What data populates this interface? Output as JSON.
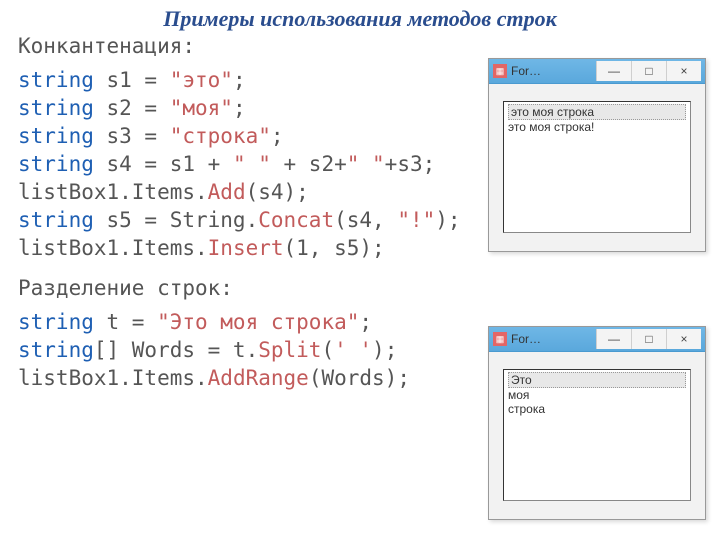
{
  "title": "Примеры использования методов строк",
  "sec1": "Конкантенация:",
  "sec2": "Разделение строк:",
  "c1": {
    "l1p1": "string",
    "l1p2": " s1 = ",
    "l1p3": "\"это\"",
    "l1p4": ";",
    "l2p1": "string",
    "l2p2": " s2 = ",
    "l2p3": "\"моя\"",
    "l2p4": ";",
    "l3p1": "string",
    "l3p2": " s3 = ",
    "l3p3": "\"строка\"",
    "l3p4": ";",
    "l4p1": "string",
    "l4p2": " s4 = s1 + ",
    "l4p3": "\" \"",
    "l4p4": " + s2+",
    "l4p5": "\" \"",
    "l4p6": "+s3;",
    "l5p1": "listBox1.Items.",
    "l5p2": "Add",
    "l5p3": "(s4);",
    "l6p1": "string",
    "l6p2": " s5 = String.",
    "l6p3": "Concat",
    "l6p4": "(s4, ",
    "l6p5": "\"!\"",
    "l6p6": ");",
    "l7p1": "listBox1.Items.",
    "l7p2": "Insert",
    "l7p3": "(1, s5);"
  },
  "c2": {
    "l1p1": "string",
    "l1p2": " t = ",
    "l1p3": "\"Это моя строка\"",
    "l1p4": ";",
    "l2p1": "string",
    "l2p2": "[] Words = t.",
    "l2p3": "Split",
    "l2p4": "(",
    "l2p5": "' '",
    "l2p6": ");",
    "l3p1": "listBox1.Items.",
    "l3p2": "AddRange",
    "l3p3": "(Words);"
  },
  "win": {
    "title": "For…",
    "min": "—",
    "max": "□",
    "close": "×"
  },
  "list1": {
    "a": "это моя строка",
    "b": "это моя строка!"
  },
  "list2": {
    "a": "Это",
    "b": "моя",
    "c": "строка"
  }
}
